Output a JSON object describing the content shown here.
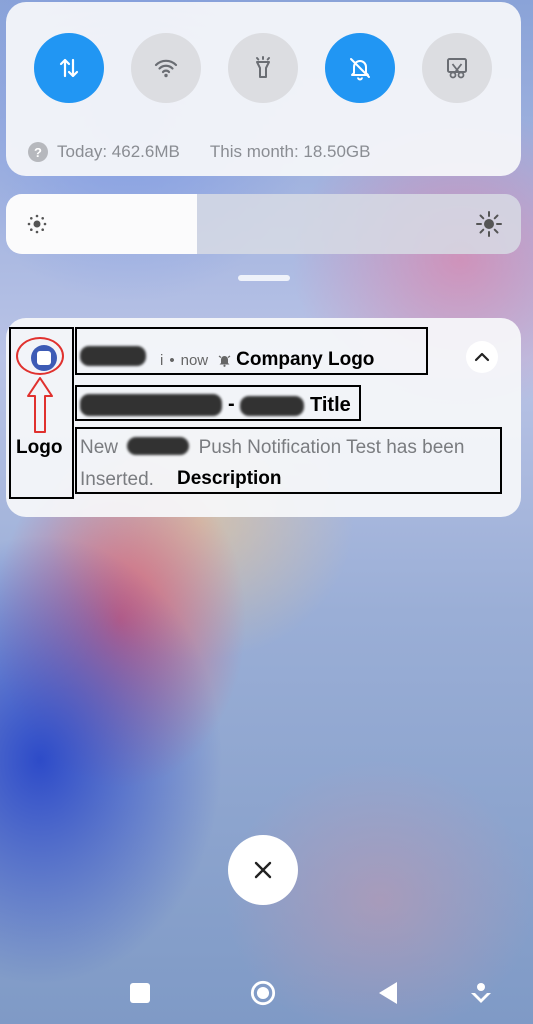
{
  "quick_settings": {
    "toggles": [
      {
        "name": "mobile-data-toggle",
        "icon": "data-arrows-icon",
        "state": "on"
      },
      {
        "name": "wifi-toggle",
        "icon": "wifi-icon",
        "state": "off"
      },
      {
        "name": "flashlight-toggle",
        "icon": "flashlight-icon",
        "state": "off"
      },
      {
        "name": "mute-toggle",
        "icon": "bell-off-icon",
        "state": "on"
      },
      {
        "name": "screenshot-toggle",
        "icon": "scissors-icon",
        "state": "off"
      }
    ],
    "usage_today": "Today: 462.6MB",
    "usage_month": "This month: 18.50GB"
  },
  "brightness": {
    "level": 0.37
  },
  "notification": {
    "app_name_suffix": "i",
    "separator": "•",
    "time": "now",
    "title_separator": "-",
    "description_prefix": "New",
    "description_rest": "Push Notification Test has been Inserted."
  },
  "annotations": {
    "company_logo": "Company Logo",
    "title": "Title",
    "logo": "Logo",
    "description": "Description"
  },
  "colors": {
    "accent": "#2196f3",
    "annotation_box": "#000000",
    "annotation_arrow": "#e0312e"
  }
}
